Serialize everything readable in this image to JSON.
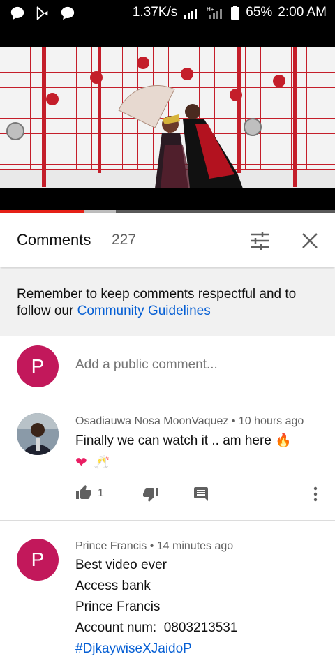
{
  "status_bar": {
    "net_speed": "1.37K/s",
    "network_type": "H+",
    "battery": "65%",
    "time": "2:00 AM",
    "icons": [
      "chat-bubble-icon",
      "play-store-icon",
      "chat-bubble-icon",
      "signal-icon",
      "signal-icon",
      "battery-icon"
    ]
  },
  "video": {
    "progress_played": 0.25,
    "progress_buffered": 0.345
  },
  "comments_header": {
    "title": "Comments",
    "count": "227",
    "icons": [
      "sort-icon",
      "close-icon"
    ]
  },
  "notice": {
    "text": "Remember to keep comments respectful and to follow our ",
    "link": "Community Guidelines"
  },
  "add_comment": {
    "avatar_letter": "P",
    "placeholder": "Add a public comment..."
  },
  "comments": [
    {
      "author": "Osadiauwa Nosa MoonVaquez",
      "separator": "•",
      "time": "10 hours ago",
      "text": "Finally we can watch it .. am here",
      "emoji_after_text": "🔥",
      "emojis": [
        "❤",
        "🥂"
      ],
      "likes": "1",
      "icons": [
        "thumb-up-icon",
        "thumb-down-icon",
        "reply-icon",
        "more-vert-icon"
      ]
    },
    {
      "author": "Prince Francis",
      "separator": "•",
      "time": "14 minutes ago",
      "avatar_letter": "P",
      "lines": [
        "Best video ever",
        "Access bank",
        "Prince Francis",
        "Account num:  0803213531"
      ],
      "hashtag": "#DjkaywiseXJaidoP"
    }
  ],
  "colors": {
    "accent_red": "#e62117",
    "avatar_pink": "#c2185b",
    "link_blue": "#065fd4"
  }
}
